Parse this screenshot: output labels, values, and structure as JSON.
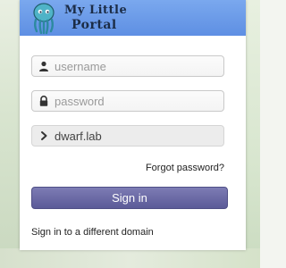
{
  "header": {
    "logo_line1": "My Little",
    "logo_line2": "Portal",
    "logo_icon": "octopus-mascot-icon"
  },
  "form": {
    "username_placeholder": "username",
    "username_icon": "user-icon",
    "password_placeholder": "password",
    "password_icon": "lock-icon",
    "domain_value": "dwarf.lab",
    "domain_icon": "chevron-right-icon",
    "forgot_label": "Forgot password?",
    "signin_label": "Sign in",
    "different_domain_label": "Sign in to a different domain"
  },
  "colors": {
    "header_blue": "#6a9be9",
    "signin_purple": "#6b6aa6",
    "mascot_teal": "#4fb3c7"
  }
}
